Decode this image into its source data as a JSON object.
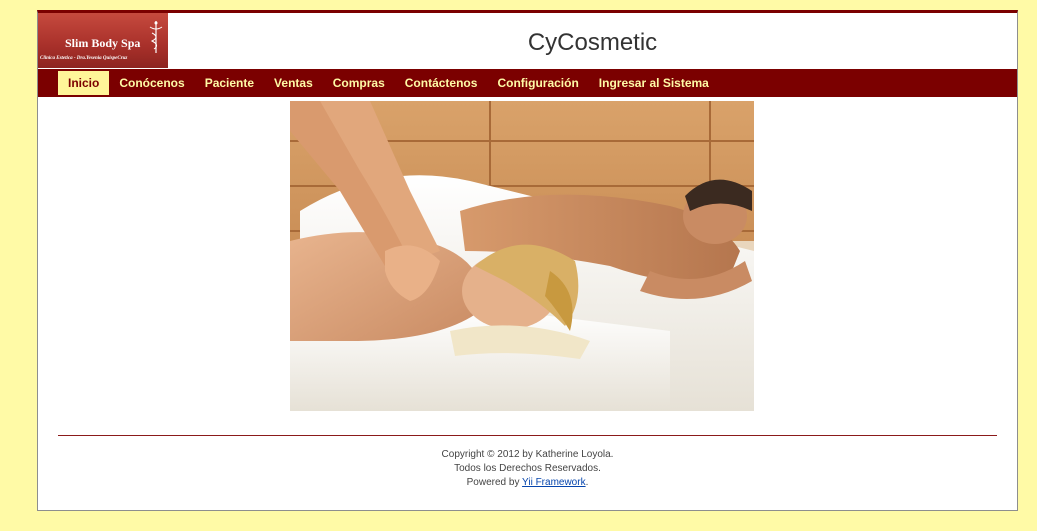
{
  "header": {
    "logo_title": "Slim Body Spa",
    "logo_subtitle": "Clinica Estetica - Dra.Yesenia QuispeCruz",
    "site_title": "CyCosmetic"
  },
  "menu": {
    "items": [
      {
        "label": "Inicio",
        "active": true
      },
      {
        "label": "Conócenos"
      },
      {
        "label": "Paciente"
      },
      {
        "label": "Ventas"
      },
      {
        "label": "Compras"
      },
      {
        "label": "Contáctenos"
      },
      {
        "label": "Configuración"
      },
      {
        "label": "Ingresar al Sistema"
      }
    ]
  },
  "footer": {
    "copyright": "Copyright © 2012 by Katherine Loyola.",
    "rights": "Todos los Derechos Reservados.",
    "powered_prefix": "Powered by ",
    "powered_link": "Yii Framework",
    "powered_suffix": "."
  },
  "colors": {
    "page_background": "#fffaa6",
    "menu_background": "#7b0000",
    "menu_text": "#fffaa6",
    "active_tab": "#fff599"
  }
}
